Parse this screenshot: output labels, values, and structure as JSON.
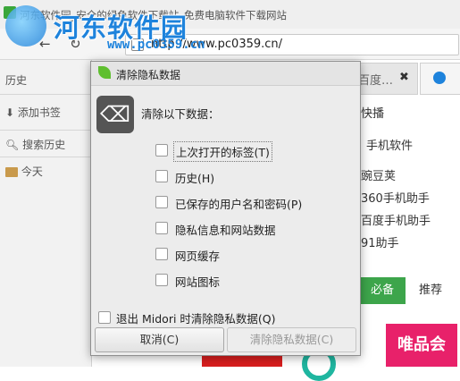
{
  "window": {
    "title": "河东软件园_安全的绿色软件下载站_免费电脑软件下载网站",
    "watermark_name": "河东软件园",
    "watermark_url": "www.pc0359.cn"
  },
  "toolbar": {
    "back": "←",
    "reload": "↻",
    "url": "http://www.pc0359.cn/"
  },
  "sidebar": {
    "header": "历史",
    "add_bookmark": "添加书签",
    "search_placeholder": "搜索历史",
    "today": "今天"
  },
  "background": {
    "tab1_label": "百度…",
    "tab1_close": "✖",
    "kuaibo": "快播",
    "mobile_software": "手机软件",
    "wandoujia": "豌豆荚",
    "helper_360": "360手机助手",
    "baidu_helper": "百度手机助手",
    "helper_91": "91助手",
    "tab_must": "必备",
    "tab_recommend": "推荐",
    "vip": "唯品会"
  },
  "dialog": {
    "title": "清除隐私数据",
    "prompt": "清除以下数据：",
    "options": [
      {
        "label": "上次打开的标签(T)",
        "checked": false
      },
      {
        "label": "历史(H)",
        "checked": false
      },
      {
        "label": "已保存的用户名和密码(P)",
        "checked": false
      },
      {
        "label": "隐私信息和网站数据",
        "checked": false
      },
      {
        "label": "网页缓存",
        "checked": false
      },
      {
        "label": "网站图标",
        "checked": false
      }
    ],
    "exit_option": "退出 Midori 时清除隐私数据(Q)",
    "cancel": "取消(C)",
    "clear": "清除隐私数据(C)"
  },
  "colors": {
    "accent_green": "#3da54b",
    "watermark_blue": "#1e83dc",
    "vip_pink": "#e8216a"
  }
}
